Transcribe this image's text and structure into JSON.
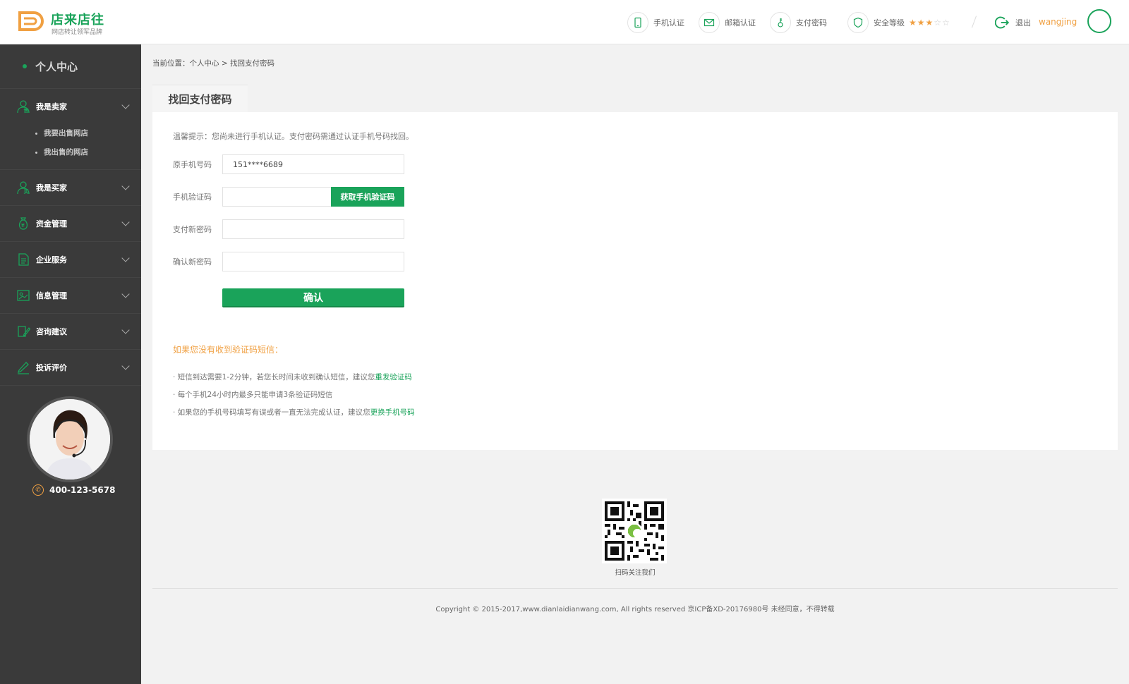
{
  "header": {
    "logo_name": "店来店往",
    "logo_sub": "网店转让领军品牌",
    "nav": [
      {
        "label": "手机认证",
        "icon": "phone-icon"
      },
      {
        "label": "邮箱认证",
        "icon": "mail-icon"
      },
      {
        "label": "支付密码",
        "icon": "key-icon"
      },
      {
        "label": "安全等级",
        "icon": "shield-icon"
      }
    ],
    "security_stars_on": "★★★",
    "security_stars_off": "☆☆",
    "security_level": 3,
    "security_level_max": 5,
    "logout_label": "退出",
    "username": "wangjing"
  },
  "sidebar": {
    "title": "个人中心",
    "groups": [
      {
        "label": "我是卖家",
        "icon": "seller-icon",
        "sub": [
          "我要出售网店",
          "我出售的网店"
        ]
      },
      {
        "label": "我是买家",
        "icon": "buyer-icon"
      },
      {
        "label": "资金管理",
        "icon": "money-bag-icon"
      },
      {
        "label": "企业服务",
        "icon": "document-icon"
      },
      {
        "label": "信息管理",
        "icon": "image-icon"
      },
      {
        "label": "咨询建议",
        "icon": "edit-icon"
      },
      {
        "label": "投诉评价",
        "icon": "pen-icon"
      }
    ],
    "phone": "400-123-5678"
  },
  "main": {
    "breadcrumb_prefix": "当前位置：",
    "breadcrumb_home": "个人中心",
    "breadcrumb_sep": ">",
    "breadcrumb_current": "找回支付密码",
    "tab_title": "找回支付密码",
    "tip": "温馨提示：您尚未进行手机认证。支付密码需通过认证手机号码找回。",
    "fields": {
      "original_phone_label": "原手机号码",
      "original_phone_value": "151****6689",
      "sms_code_label": "手机验证码",
      "sms_code_value": "",
      "get_code_button": "获取手机验证码",
      "new_password_label": "支付新密码",
      "new_password_value": "",
      "confirm_password_label": "确认新密码",
      "confirm_password_value": ""
    },
    "confirm_button": "确认",
    "help": {
      "title": "如果您没有收到验证码短信：",
      "line1_text": "· 短信到达需要1-2分钟，若您长时间未收到确认短信，建议您",
      "line1_link": "重发验证码",
      "line2_text": "· 每个手机24小时内最多只能申请3条验证码短信",
      "line3_text": "· 如果您的手机号码填写有误或者一直无法完成认证，建议您",
      "line3_link": "更换手机号码"
    }
  },
  "footer": {
    "qr_caption": "扫码关注我们",
    "copyright": "Copyright © 2015-2017,www.dianlaidianwang.com, All rights reserved 京ICP备XD-20176980号 未经同意，不得转载"
  },
  "colors": {
    "brand_green": "#1aa35a",
    "accent_orange": "#f0a042",
    "sidebar_bg": "#3a3a3a"
  }
}
